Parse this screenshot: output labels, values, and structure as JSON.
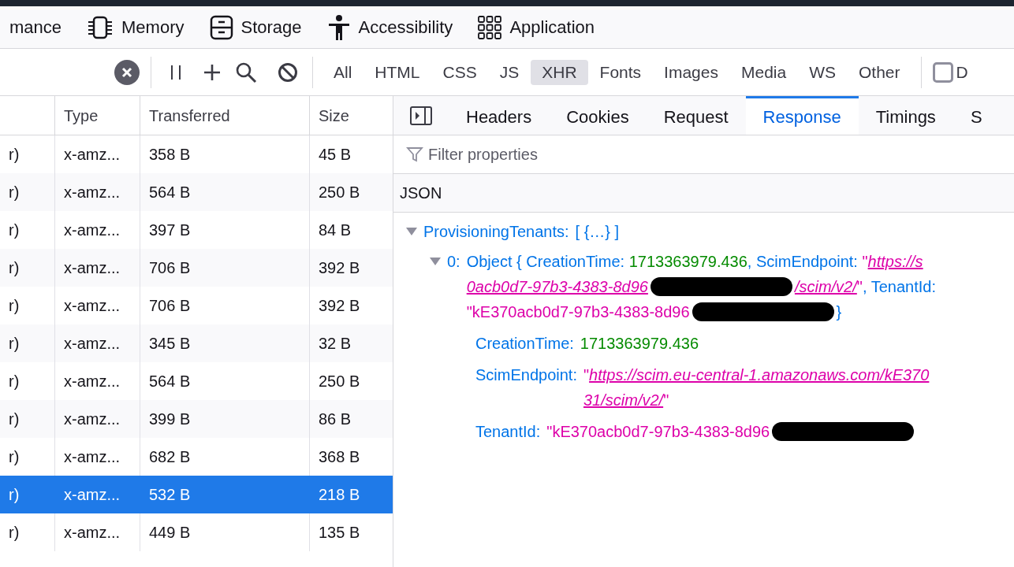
{
  "panel_tabs": [
    {
      "label": "mance",
      "selected": false
    },
    {
      "label": "Memory",
      "selected": false
    },
    {
      "label": "Storage",
      "selected": false
    },
    {
      "label": "Accessibility",
      "selected": false
    },
    {
      "label": "Application",
      "selected": false
    }
  ],
  "toolbar": {
    "filters": [
      {
        "label": "All",
        "selected": false
      },
      {
        "label": "HTML",
        "selected": false
      },
      {
        "label": "CSS",
        "selected": false
      },
      {
        "label": "JS",
        "selected": false
      },
      {
        "label": "XHR",
        "selected": true
      },
      {
        "label": "Fonts",
        "selected": false
      },
      {
        "label": "Images",
        "selected": false
      },
      {
        "label": "Media",
        "selected": false
      },
      {
        "label": "WS",
        "selected": false
      },
      {
        "label": "Other",
        "selected": false
      }
    ],
    "checkbox": {
      "label": "D",
      "checked": false
    }
  },
  "table": {
    "columns": [
      "",
      "Type",
      "Transferred",
      "Size"
    ],
    "rows": [
      {
        "cells": [
          "r)",
          "x-amz...",
          "358 B",
          "45 B"
        ],
        "selected": false
      },
      {
        "cells": [
          "r)",
          "x-amz...",
          "564 B",
          "250 B"
        ],
        "selected": false
      },
      {
        "cells": [
          "r)",
          "x-amz...",
          "397 B",
          "84 B"
        ],
        "selected": false
      },
      {
        "cells": [
          "r)",
          "x-amz...",
          "706 B",
          "392 B"
        ],
        "selected": false
      },
      {
        "cells": [
          "r)",
          "x-amz...",
          "706 B",
          "392 B"
        ],
        "selected": false
      },
      {
        "cells": [
          "r)",
          "x-amz...",
          "345 B",
          "32 B"
        ],
        "selected": false
      },
      {
        "cells": [
          "r)",
          "x-amz...",
          "564 B",
          "250 B"
        ],
        "selected": false
      },
      {
        "cells": [
          "r)",
          "x-amz...",
          "399 B",
          "86 B"
        ],
        "selected": false
      },
      {
        "cells": [
          "r)",
          "x-amz...",
          "682 B",
          "368 B"
        ],
        "selected": false
      },
      {
        "cells": [
          "r)",
          "x-amz...",
          "532 B",
          "218 B"
        ],
        "selected": true
      },
      {
        "cells": [
          "r)",
          "x-amz...",
          "449 B",
          "135 B"
        ],
        "selected": false
      }
    ]
  },
  "details": {
    "tabs": [
      {
        "label": "Headers",
        "selected": false
      },
      {
        "label": "Cookies",
        "selected": false
      },
      {
        "label": "Request",
        "selected": false
      },
      {
        "label": "Response",
        "selected": true
      },
      {
        "label": "Timings",
        "selected": false
      },
      {
        "label": "S",
        "selected": false
      }
    ],
    "filter": {
      "placeholder": "Filter properties"
    },
    "section": "JSON",
    "tree": [
      {
        "key": "ProvisioningTenants:",
        "preview": [
          [
            {
              "kind": "punct",
              "text": "[ {…} ]"
            }
          ]
        ],
        "expanded": true,
        "children": [
          {
            "key": "0:",
            "expanded": true,
            "preview": [
              [
                {
                  "kind": "punct",
                  "text": "Object { CreationTime: "
                },
                {
                  "kind": "number",
                  "text": "1713363979.436"
                },
                {
                  "kind": "punct",
                  "text": ", ScimEndpoint: "
                },
                {
                  "kind": "string",
                  "text": "\""
                },
                {
                  "kind": "link",
                  "text": "https://s"
                }
              ],
              [
                {
                  "kind": "link",
                  "text": "0acb0d7-97b3-4383-8d96"
                },
                {
                  "kind": "redacted"
                },
                {
                  "kind": "link",
                  "text": "/scim/v2/"
                },
                {
                  "kind": "string",
                  "text": "\""
                },
                {
                  "kind": "punct",
                  "text": ", TenantId:"
                }
              ],
              [
                {
                  "kind": "string",
                  "text": "\"kE370acb0d7-97b3-4383-8d96"
                },
                {
                  "kind": "redacted"
                },
                {
                  "kind": "punct",
                  "text": "}"
                }
              ]
            ],
            "children": [
              {
                "key": "CreationTime:",
                "value": [
                  [
                    {
                      "kind": "number",
                      "text": "1713363979.436"
                    }
                  ]
                ]
              },
              {
                "key": "ScimEndpoint:",
                "value": [
                  [
                    {
                      "kind": "string",
                      "text": "\""
                    },
                    {
                      "kind": "link",
                      "text": "https://scim.eu-central-1.amazonaws.com/kE370"
                    }
                  ],
                  [
                    {
                      "kind": "link",
                      "text": "31/scim/v2/"
                    },
                    {
                      "kind": "string",
                      "text": "\""
                    }
                  ]
                ]
              },
              {
                "key": "TenantId:",
                "value": [
                  [
                    {
                      "kind": "string",
                      "text": "\"kE370acb0d7-97b3-4383-8d96"
                    },
                    {
                      "kind": "redacted"
                    }
                  ]
                ]
              }
            ]
          }
        ]
      }
    ]
  }
}
